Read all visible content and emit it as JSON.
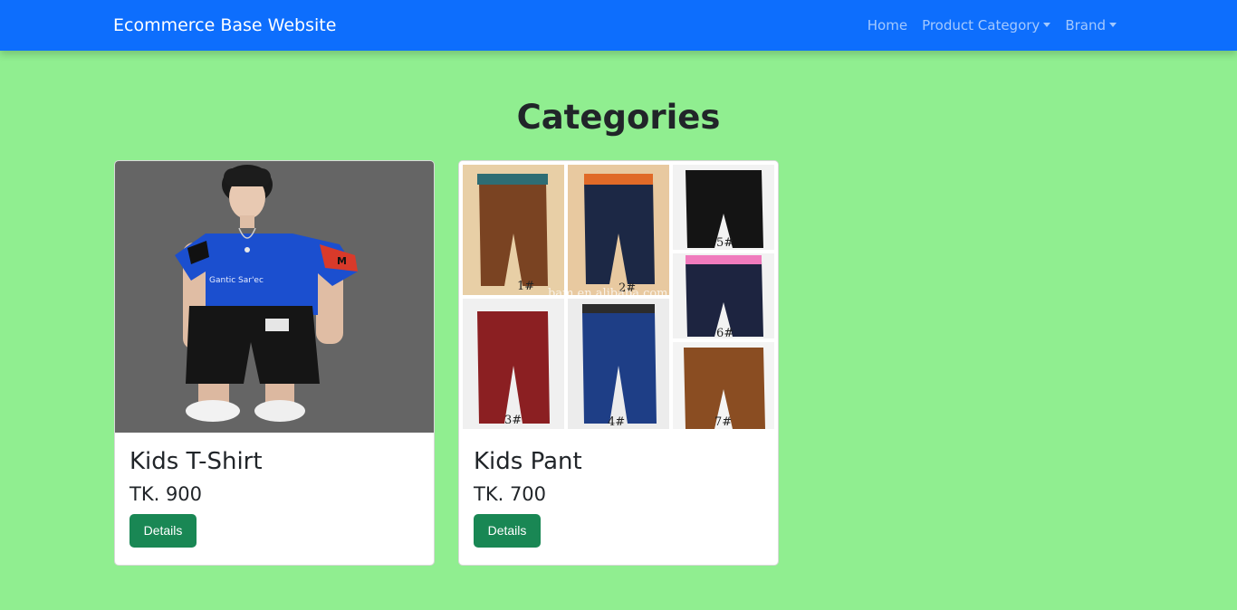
{
  "navbar": {
    "brand": "Ecommerce Base Website",
    "links": [
      {
        "label": "Home",
        "dropdown": false
      },
      {
        "label": "Product Category",
        "dropdown": true
      },
      {
        "label": "Brand",
        "dropdown": true
      }
    ]
  },
  "page": {
    "heading": "Categories"
  },
  "products": [
    {
      "title": "Kids T-Shirt",
      "price": "TK. 900",
      "button": "Details",
      "image": "boy-in-blue-tshirt-photo",
      "shirt_print": "Gantic Sar'ec",
      "sleeve_print": "M"
    },
    {
      "title": "Kids Pant",
      "price": "TK. 700",
      "button": "Details",
      "image": "kids-pants-collage-photo",
      "watermark": "bam.en.alibaba.com",
      "labels": [
        "1#",
        "2#",
        "3#",
        "4#",
        "5#",
        "6#",
        "7#"
      ]
    }
  ],
  "colors": {
    "navbar": "#0d6efd",
    "background": "#90ee90",
    "button": "#198754"
  }
}
